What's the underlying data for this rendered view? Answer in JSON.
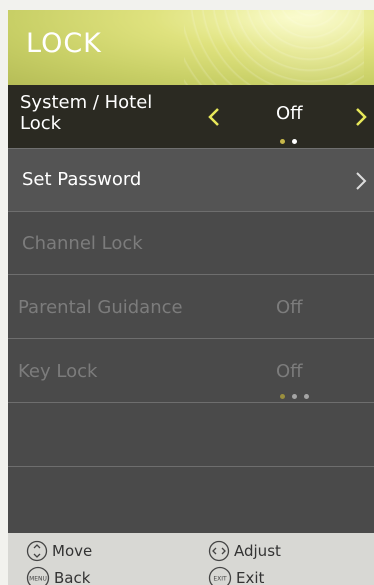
{
  "header": {
    "title": "LOCK"
  },
  "menu": {
    "items": [
      {
        "label": "System / Hotel\nLock",
        "value": "Off"
      },
      {
        "label": "Set Password"
      },
      {
        "label": "Channel Lock"
      },
      {
        "label": "Parental Guidance",
        "value": "Off"
      },
      {
        "label": "Key Lock",
        "value": "Off"
      }
    ]
  },
  "footer": {
    "move": "Move",
    "adjust": "Adjust",
    "back": "Back",
    "exit": "Exit",
    "back_icon_text": "MENU",
    "exit_icon_text": "EXIT"
  },
  "colors": {
    "header_yellow": "#dfe27e",
    "focus_background": "#2b2a22",
    "arrow_yellow": "#e8e85a",
    "dot_active": "#c8b84a"
  },
  "icons": [
    "chevron-left-icon",
    "chevron-right-icon",
    "move-icon",
    "adjust-icon",
    "menu-button-icon",
    "exit-button-icon"
  ]
}
